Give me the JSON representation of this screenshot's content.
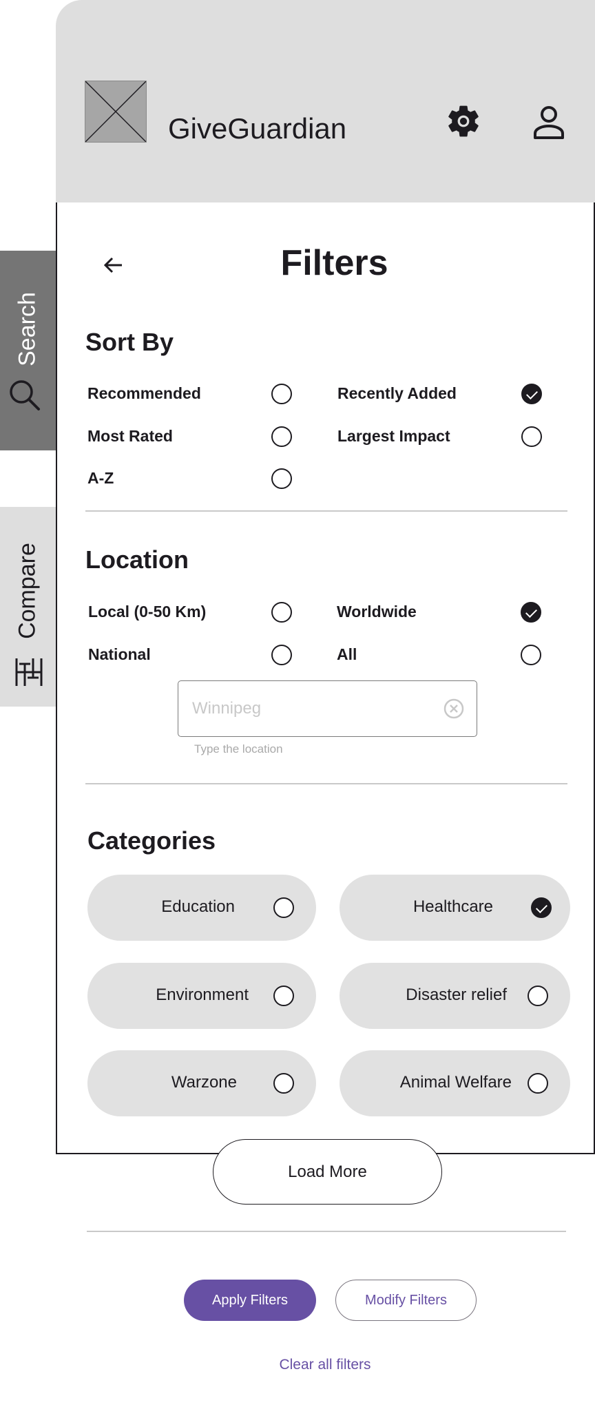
{
  "header": {
    "app_title": "GiveGuardian",
    "logo_icon": "image-placeholder-icon",
    "settings_icon": "gear-icon",
    "profile_icon": "person-icon",
    "background": "#dedede"
  },
  "side_tabs": {
    "search": {
      "label": "Search",
      "icon": "search-icon",
      "background": "#757575"
    },
    "compare": {
      "label": "Compare",
      "icon": "compare-sliders-icon",
      "background": "#dedede"
    }
  },
  "filters": {
    "title": "Filters",
    "back_icon": "arrow-left-icon",
    "sort_by": {
      "title": "Sort By",
      "options": [
        {
          "label": "Recommended",
          "checked": false
        },
        {
          "label": "Recently Added",
          "checked": true
        },
        {
          "label": "Most Rated",
          "checked": false
        },
        {
          "label": "Largest Impact",
          "checked": false
        },
        {
          "label": "A-Z",
          "checked": false
        }
      ]
    },
    "location": {
      "title": "Location",
      "options": [
        {
          "label": "Local (0-50 Km)",
          "checked": false
        },
        {
          "label": "Worldwide",
          "checked": true
        },
        {
          "label": "National",
          "checked": false
        },
        {
          "label": "All",
          "checked": false
        }
      ],
      "input_value": "",
      "input_placeholder": "Winnipeg",
      "input_help": "Type the location",
      "clear_icon": "circle-x-icon"
    },
    "categories": {
      "title": "Categories",
      "items": [
        {
          "label": "Education",
          "checked": false
        },
        {
          "label": "Healthcare",
          "checked": true
        },
        {
          "label": "Environment",
          "checked": false
        },
        {
          "label": "Disaster relief",
          "checked": false
        },
        {
          "label": "Warzone",
          "checked": false
        },
        {
          "label": "Animal Welfare",
          "checked": false
        }
      ]
    }
  },
  "actions": {
    "load_more": "Load More",
    "apply": "Apply Filters",
    "modify": "Modify Filters",
    "clear_all": "Clear all filters"
  },
  "colors": {
    "accent": "#6750a4",
    "text": "#1d1b20",
    "chip_bg": "#e1e1e1"
  }
}
